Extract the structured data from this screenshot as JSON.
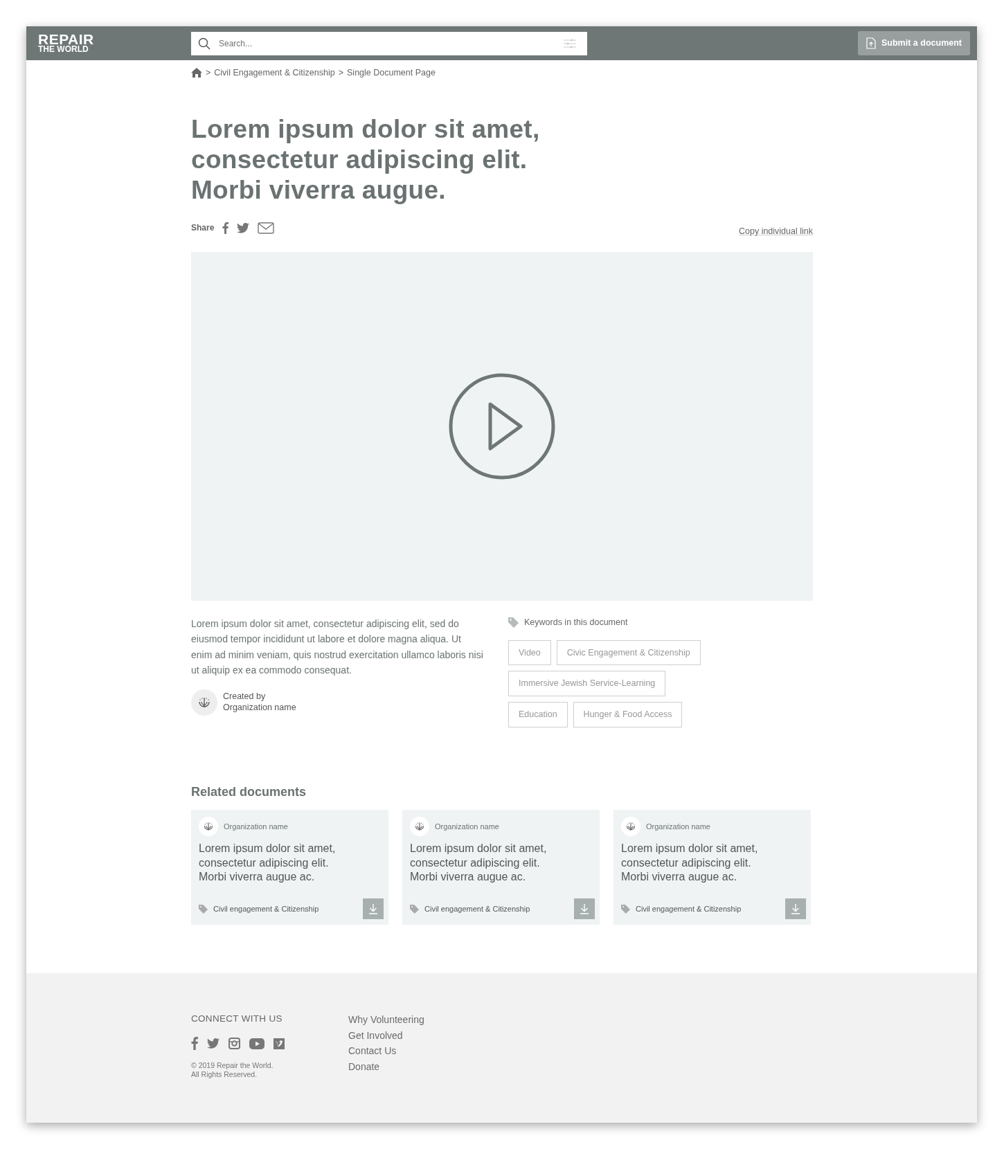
{
  "header": {
    "logo": [
      "REPAIR",
      "THE WORLD"
    ],
    "search": {
      "placeholder": "Search..."
    },
    "submit_button": "Submit a document"
  },
  "breadcrumb": {
    "separator": ">",
    "items": [
      "Civil Engagement & Citizenship",
      "Single Document Page"
    ]
  },
  "title_lines": [
    "Lorem ipsum dolor sit amet,",
    "consectetur adipiscing elit.",
    "Morbi viverra augue."
  ],
  "share": {
    "label": "Share",
    "copy_link": "Copy individual link"
  },
  "description": "Lorem ipsum dolor sit amet, consectetur adipiscing elit, sed do eiusmod tempor incididunt ut labore et dolore magna aliqua. Ut enim ad minim veniam, quis nostrud exercitation ullamco laboris nisi ut aliquip ex ea commodo consequat.",
  "creator": {
    "label": "Created by",
    "name": "Organization name"
  },
  "keywords": {
    "heading": "Keywords in this document",
    "tag_rows": [
      [
        "Video",
        "Civic Engagement & Citizenship"
      ],
      [
        "Immersive Jewish Service-Learning"
      ],
      [
        "Education",
        "Hunger & Food Access"
      ]
    ]
  },
  "related": {
    "heading": "Related documents",
    "cards": [
      {
        "org": "Organization name",
        "title": "Lorem ipsum dolor sit amet, consectetur adipiscing elit. Morbi viverra augue ac.",
        "tag": "Civil engagement & Citizenship"
      },
      {
        "org": "Organization name",
        "title": "Lorem ipsum dolor sit amet, consectetur adipiscing elit. Morbi viverra augue ac.",
        "tag": "Civil engagement & Citizenship"
      },
      {
        "org": "Organization name",
        "title": "Lorem ipsum dolor sit amet, consectetur adipiscing elit. Morbi viverra augue ac.",
        "tag": "Civil engagement & Citizenship"
      }
    ]
  },
  "footer": {
    "connect_heading": "CONNECT WITH US",
    "copyright": [
      "© 2019 Repair the World.",
      "All Rights Reserved."
    ],
    "links": [
      "Why Volunteering",
      "Get Involved",
      "Contact Us",
      "Donate"
    ]
  }
}
